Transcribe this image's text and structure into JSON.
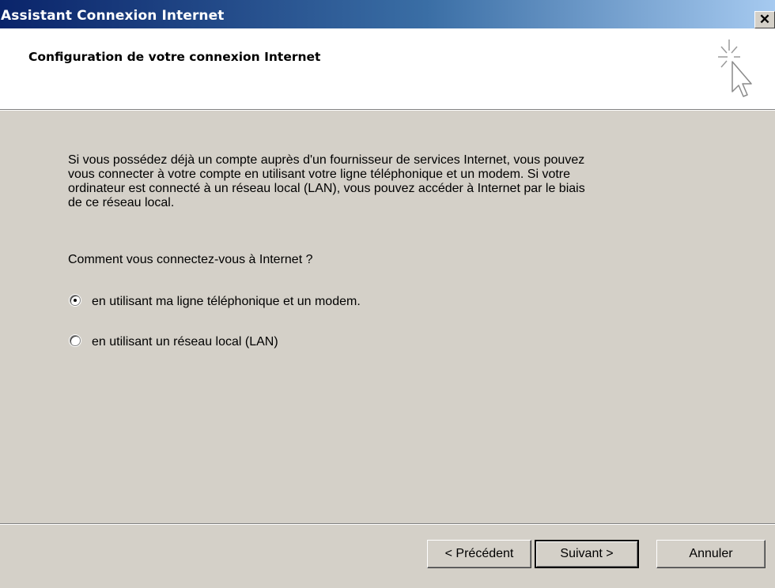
{
  "window": {
    "title": "Assistant Connexion Internet",
    "close_symbol": "✕"
  },
  "header": {
    "title": "Configuration de votre connexion Internet",
    "icon": "cursor-sparkle-icon"
  },
  "body": {
    "intro_lines": [
      "Si vous possédez déjà un compte auprès d'un fournisseur de services Internet, vous pouvez",
      "vous connecter à votre compte en utilisant votre ligne téléphonique et un modem. Si votre",
      "ordinateur est connecté à un réseau local (LAN), vous pouvez accéder à Internet par le biais",
      "de ce réseau local."
    ],
    "question": "Comment vous connectez-vous à Internet ?",
    "options": [
      {
        "label": "en utilisant ma ligne téléphonique et un modem.",
        "selected": true
      },
      {
        "label": "en utilisant un réseau local (LAN)",
        "selected": false
      }
    ]
  },
  "buttons": {
    "back": "< Précédent",
    "next": "Suivant >",
    "cancel": "Annuler"
  },
  "colors": {
    "titlebar_start": "#0a246a",
    "titlebar_end": "#a6caf0",
    "dialog_bg": "#d4d0c8"
  }
}
